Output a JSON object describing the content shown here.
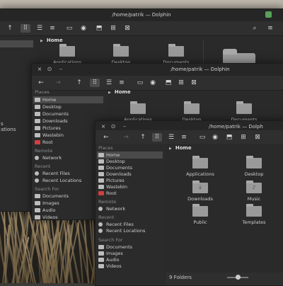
{
  "windows": [
    {
      "title": "/home/patrik — Dolphin",
      "breadcrumb": "Home",
      "folders": [
        "Applications",
        "Desktop",
        "Documents"
      ],
      "sidebar_fragment": [
        "s",
        "ations"
      ]
    },
    {
      "title": "/home/patrik — Dolphin",
      "breadcrumb": "Home",
      "places_header": "Places",
      "places": [
        "Home",
        "Desktop",
        "Documents",
        "Downloads",
        "Pictures",
        "Wastebin",
        "Root"
      ],
      "remote_header": "Remote",
      "remote": [
        "Network"
      ],
      "recent_header": "Recent",
      "recent": [
        "Recent Files",
        "Recent Locations"
      ],
      "search_header": "Search For",
      "search": [
        "Documents",
        "Images",
        "Audio",
        "Videos"
      ],
      "folders": [
        "Applications",
        "Desktop",
        "Documents"
      ]
    },
    {
      "title": "/home/patrik — Dolph",
      "breadcrumb": "Home",
      "places_header": "Places",
      "places": [
        "Home",
        "Desktop",
        "Documents",
        "Downloads",
        "Pictures",
        "Wastebin",
        "Root"
      ],
      "remote_header": "Remote",
      "remote": [
        "Network"
      ],
      "recent_header": "Recent",
      "recent": [
        "Recent Files",
        "Recent Locations"
      ],
      "search_header": "Search For",
      "search": [
        "Documents",
        "Images",
        "Audio",
        "Videos"
      ],
      "folders": [
        "Applications",
        "Desktop",
        "Downloads",
        "Music",
        "Public",
        "Templates"
      ],
      "status": "9 Folders"
    }
  ],
  "icons": {
    "back": "←",
    "forward": "→",
    "up": "↑",
    "menu": "≡",
    "search": "⌕",
    "x": "×",
    "caret": "▶",
    "music": "♪",
    "download": "↓"
  },
  "colors": {
    "selection": "#4a4a4a",
    "root_icon": "#d04040",
    "folder": "#9a9a9a"
  }
}
